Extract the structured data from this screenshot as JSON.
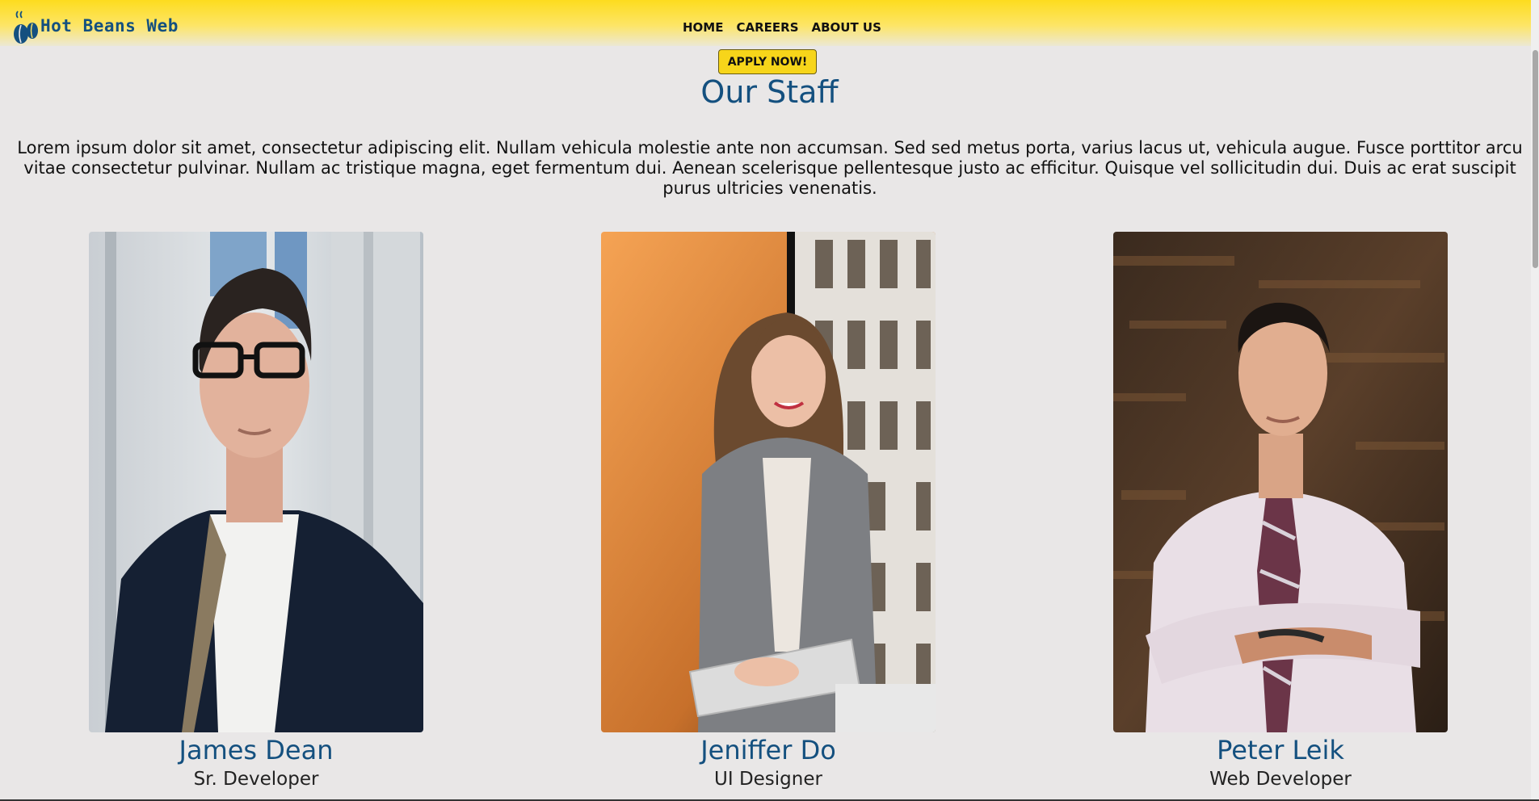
{
  "brand": {
    "name": "Hot Beans Web",
    "logo_icon": "coffee-beans-icon",
    "color": "#14507f"
  },
  "nav": {
    "items": [
      {
        "label": "HOME"
      },
      {
        "label": "CAREERS"
      },
      {
        "label": "ABOUT US"
      }
    ]
  },
  "cta": {
    "label": "APPLY NOW!",
    "color": "#f7d51a"
  },
  "page": {
    "title": "Our Staff",
    "intro": "Lorem ipsum dolor sit amet, consectetur adipiscing elit. Nullam vehicula molestie ante non accumsan. Sed sed metus porta, varius lacus ut, vehicula augue. Fusce porttitor arcu vitae consectetur pulvinar. Nullam ac tristique magna, eget fermentum dui. Aenean scelerisque pellentesque justo ac efficitur. Quisque vel sollicitudin dui. Duis ac erat suscipit purus ultricies venenatis."
  },
  "staff": [
    {
      "name": "James Dean",
      "role": "Sr. Developer"
    },
    {
      "name": "Jeniffer Do",
      "role": "UI Designer"
    },
    {
      "name": "Peter Leik",
      "role": "Web Developer"
    }
  ],
  "colors": {
    "header_yellow": "#fddc1e",
    "page_bg": "#e9e7e7",
    "heading_blue": "#14507f"
  }
}
